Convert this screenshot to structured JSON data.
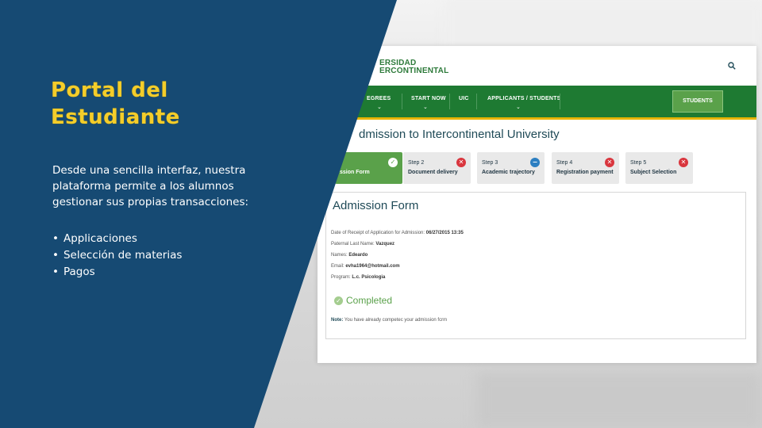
{
  "slide": {
    "heading_line1": "Portal del",
    "heading_line2": "Estudiante",
    "description": "Desde una sencilla interfaz, nuestra plataforma permite a los alumnos gestionar sus propias transacciones:",
    "bullets": [
      "Applicaciones",
      "Selección de materias",
      "Pagos"
    ],
    "colors": {
      "panel": "#164a73",
      "accent": "#f4cd2a"
    }
  },
  "portal": {
    "logo_line1": "ERSIDAD",
    "logo_line2": "ERCONTINENTAL",
    "nav": [
      "EGREES",
      "START NOW",
      "UIC",
      "APPLICANTS / STUDENTS"
    ],
    "students_button": "STUDENTS",
    "page_title": "dmission to Intercontinental University",
    "steps": [
      {
        "title": "",
        "label": "ssion Form",
        "status": "done"
      },
      {
        "title": "Step 2",
        "label": "Document delivery",
        "status": "error"
      },
      {
        "title": "Step 3",
        "label": "Academic trajectory",
        "status": "info"
      },
      {
        "title": "Step 4",
        "label": "Registration payment",
        "status": "error"
      },
      {
        "title": "Step 5",
        "label": "Subject Selection",
        "status": "error"
      }
    ],
    "form": {
      "title": "Admission Form",
      "receipt_label": "Date of Receipt of Application for Admission:",
      "receipt_value": "06/27/2015 13:35",
      "paternal_label": "Paternal Last Name:",
      "paternal_value": "Vazquez",
      "names_label": "Names:",
      "names_value": "Edeardo",
      "email_label": "Email:",
      "email_value": "evha1964@hotmail.com",
      "program_label": "Program:",
      "program_value": "L.c. Psicologia",
      "status": "Completed",
      "note_label": "Note:",
      "note_text": "You have already competec your admission fcrm"
    },
    "colors": {
      "nav": "#1e7a32",
      "stripe": "#e6b400",
      "active_step": "#5aa14a"
    }
  }
}
